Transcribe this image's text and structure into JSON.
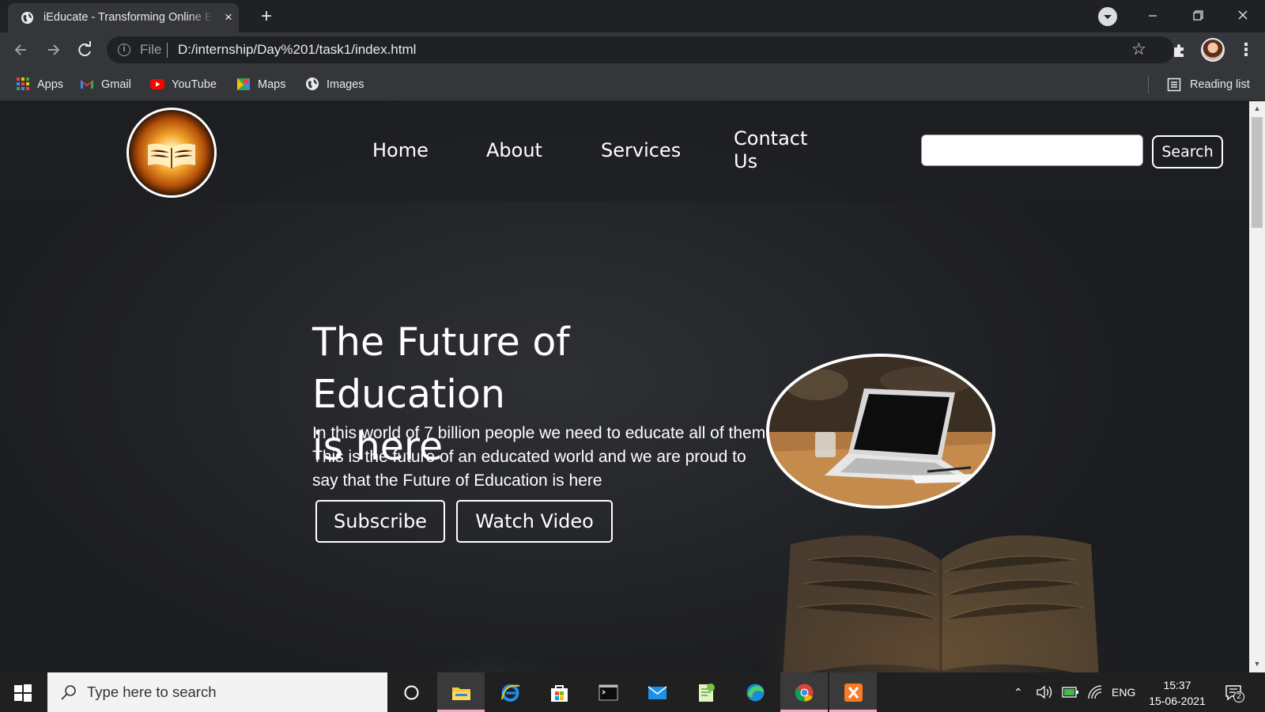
{
  "browser": {
    "tab_title": "iEducate - Transforming Online Education",
    "tab_close": "×",
    "new_tab": "+",
    "omnibox_scheme": "File",
    "omnibox_url": "D:/internship/Day%201/task1/index.html",
    "bookmarks": [
      {
        "label": "Apps",
        "icon": "apps-grid-icon"
      },
      {
        "label": "Gmail",
        "icon": "gmail-icon"
      },
      {
        "label": "YouTube",
        "icon": "youtube-icon"
      },
      {
        "label": "Maps",
        "icon": "maps-icon"
      },
      {
        "label": "Images",
        "icon": "globe-icon"
      }
    ],
    "reading_list": "Reading list"
  },
  "site": {
    "logo": "book-logo",
    "nav": {
      "home": "Home",
      "about": "About",
      "services": "Services",
      "contact_line1": "Contact",
      "contact_line2": "Us"
    },
    "search_value": "",
    "search_button": "Search",
    "hero": {
      "title_line1": "The Future of Education",
      "title_line2": "is here",
      "text": "In this world of 7 billion people we need to educate all of them. This is the future of an educated world and we are proud to say that the Future of Education is here",
      "subscribe": "Subscribe",
      "watch_video": "Watch Video"
    }
  },
  "taskbar": {
    "search_placeholder": "Type here to search",
    "apps": [
      "task-view",
      "file-explorer",
      "internet-explorer",
      "microsoft-store",
      "terminal",
      "mail",
      "notepad-plus",
      "edge",
      "chrome",
      "xampp"
    ],
    "language": "ENG",
    "time": "15:37",
    "date": "15-06-2021",
    "notifications": "2"
  },
  "colors": {
    "accent_active_app": "#f7a7c1",
    "chrome_dark": "#35363a",
    "page_bg": "#2a2b2e"
  }
}
